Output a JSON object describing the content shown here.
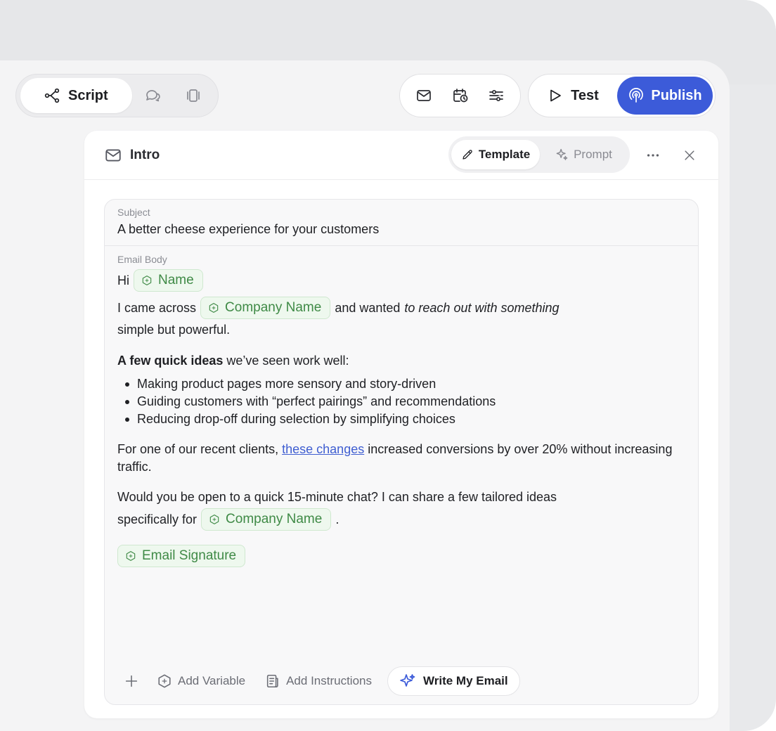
{
  "toolbar": {
    "script_label": "Script",
    "test_label": "Test",
    "publish_label": "Publish"
  },
  "card": {
    "title": "Intro",
    "template_label": "Template",
    "prompt_label": "Prompt"
  },
  "email": {
    "subject_label": "Subject",
    "subject": "A better cheese experience for your customers",
    "body_label": "Email Body",
    "greeting": "Hi",
    "var_name": "Name",
    "p1_start": "I came across",
    "var_company": "Company Name",
    "p1_mid": "and wanted",
    "p1_italic": "to reach out with something",
    "p1_end": "simple but powerful.",
    "p2_bold": "A few quick ideas",
    "p2_rest": " we’ve seen work well:",
    "ideas": [
      "Making product pages more sensory and story-driven",
      "Guiding customers with “perfect pairings” and recommendations",
      "Reducing drop-off during selection by simplifying choices"
    ],
    "p3_start": "For one of our recent clients, ",
    "p3_link": "these changes",
    "p3_end": " increased conversions by over 20% without increasing traffic.",
    "p4_line1": "Would you be open to a quick 15-minute chat? I can share a few tailored ideas",
    "p4_line2": "specifically for",
    "p4_end": ".",
    "var_signature": "Email Signature"
  },
  "footer": {
    "add_variable": "Add Variable",
    "add_instructions": "Add Instructions",
    "write_email": "Write My Email"
  },
  "colors": {
    "accent": "#3c5bd9",
    "variable_green": "#3f8a46",
    "link": "#3f5ed1"
  }
}
